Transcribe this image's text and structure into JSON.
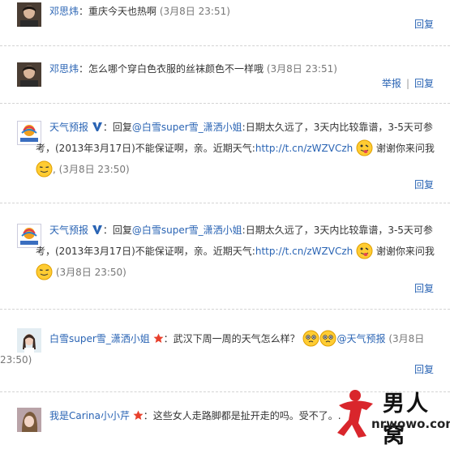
{
  "comments": [
    {
      "user": "邓思炜",
      "text": "：重庆今天也热啊",
      "time": "(3月8日 23:51)",
      "actions": [
        "回复"
      ]
    },
    {
      "user": "邓思炜",
      "text": "：怎么哪个穿白色衣服的丝袜颜色不一样哦",
      "time": "(3月8日 23:51)",
      "actions": [
        "举报",
        "回复"
      ]
    },
    {
      "user": "天气预报",
      "verified": true,
      "prefix": "：回复",
      "mention": "@白雪super雪_潇洒小姐",
      "text1": ":日期太久远了，3天内比较靠谱，3-5天可参",
      "text2": "考，(2013年3月17日)不能保证啊，亲。近期天气:",
      "link": "http://t.cn/zWZVCzh",
      "text3": "谢谢你来问我",
      "time": ", (3月8日 23:50)",
      "actions": [
        "回复"
      ]
    },
    {
      "user": "天气预报",
      "verified": true,
      "prefix": "：回复",
      "mention": "@白雪super雪_潇洒小姐",
      "text1": ":日期太久远了，3天内比较靠谱，3-5天可参",
      "text2": "考，(2013年3月17日)不能保证啊，亲。近期天气:",
      "link": "http://t.cn/zWZVCzh",
      "text3": "谢谢你来问我",
      "time": "(3月8日 23:50)",
      "actions": [
        "回复"
      ]
    },
    {
      "user": "白雪super雪_潇洒小姐",
      "star": true,
      "text": "：武汉下周一周的天气怎么样？",
      "mention": "@天气预报",
      "time1": "(3月8日",
      "time2": "23:50)",
      "actions": [
        "回复"
      ]
    },
    {
      "user": "我是Carina小小芹",
      "star": true,
      "text": "：这些女人走路脚都是扯开走的吗。受不了。."
    }
  ],
  "watermark": {
    "title": "男人窝",
    "url": "nrwowo.com"
  },
  "colors": {
    "link": "#2a64b4",
    "divider": "#d4d4d4",
    "watermark_red": "#d9262c"
  }
}
